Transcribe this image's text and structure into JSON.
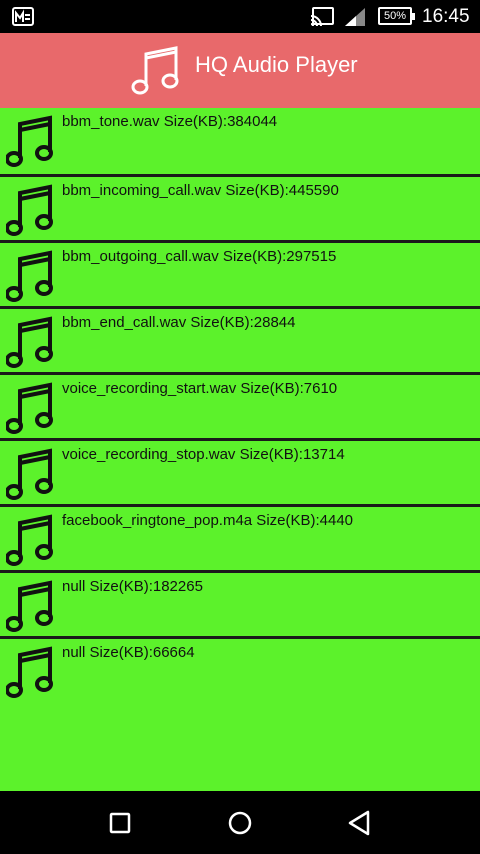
{
  "status_bar": {
    "battery": "50%",
    "time": "16:45",
    "icons": [
      "gallery-icon",
      "cast-icon",
      "signal-icon",
      "battery-icon"
    ]
  },
  "app_bar": {
    "title": "HQ Audio Player",
    "icon": "music-note-icon"
  },
  "tracks": [
    {
      "label": "bbm_tone.wav Size(KB):384044"
    },
    {
      "label": "bbm_incoming_call.wav Size(KB):445590"
    },
    {
      "label": "bbm_outgoing_call.wav Size(KB):297515"
    },
    {
      "label": "bbm_end_call.wav Size(KB):28844"
    },
    {
      "label": "voice_recording_start.wav Size(KB):7610"
    },
    {
      "label": "voice_recording_stop.wav Size(KB):13714"
    },
    {
      "label": "facebook_ringtone_pop.m4a Size(KB):4440"
    },
    {
      "label": "null Size(KB):182265"
    },
    {
      "label": "null Size(KB):66664"
    }
  ],
  "nav_bar": {
    "buttons": [
      "recents-button",
      "home-button",
      "back-button"
    ]
  },
  "colors": {
    "app_bar": "#e8696b",
    "list_background": "#5cf22b",
    "divider": "#1a1a1a"
  }
}
